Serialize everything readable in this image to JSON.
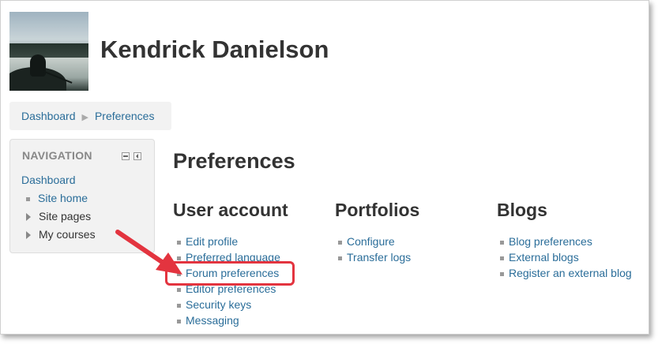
{
  "user": {
    "name": "Kendrick Danielson"
  },
  "breadcrumb": {
    "items": [
      "Dashboard",
      "Preferences"
    ]
  },
  "navigation": {
    "title": "NAVIGATION",
    "dashboard": "Dashboard",
    "items": [
      "Site home",
      "Site pages",
      "My courses"
    ]
  },
  "page": {
    "title": "Preferences"
  },
  "columns": [
    {
      "title": "User account",
      "links": [
        "Edit profile",
        "Preferred language",
        "Forum preferences",
        "Editor preferences",
        "Security keys",
        "Messaging"
      ]
    },
    {
      "title": "Portfolios",
      "links": [
        "Configure",
        "Transfer logs"
      ]
    },
    {
      "title": "Blogs",
      "links": [
        "Blog preferences",
        "External blogs",
        "Register an external blog"
      ]
    }
  ],
  "annotation": {
    "color": "#e3343f",
    "target": "Forum preferences"
  },
  "colors": {
    "link": "#2a6d99",
    "text": "#333333",
    "block_bg": "#f2f2f2"
  }
}
